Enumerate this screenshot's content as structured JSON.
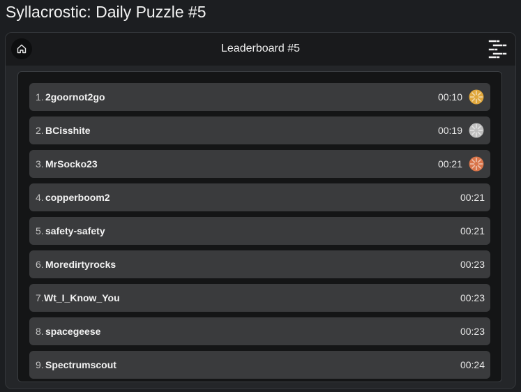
{
  "page_title": "Syllacrostic: Daily Puzzle #5",
  "header": {
    "title": "Leaderboard #5",
    "home_icon": "home-icon",
    "menu_icon": "menu-lines-icon"
  },
  "colors": {
    "gold": "#e0a73c",
    "silver": "#bfbfbf",
    "bronze": "#d9754a"
  },
  "leaderboard": [
    {
      "rank": "1.",
      "name": "2goornot2go",
      "time": "00:10",
      "medal": "gold"
    },
    {
      "rank": "2.",
      "name": "BCisshite",
      "time": "00:19",
      "medal": "silver"
    },
    {
      "rank": "3.",
      "name": "MrSocko23",
      "time": "00:21",
      "medal": "bronze"
    },
    {
      "rank": "4.",
      "name": "copperboom2",
      "time": "00:21",
      "medal": ""
    },
    {
      "rank": "5.",
      "name": "safety-safety",
      "time": "00:21",
      "medal": ""
    },
    {
      "rank": "6.",
      "name": "Moredirtyrocks",
      "time": "00:23",
      "medal": ""
    },
    {
      "rank": "7.",
      "name": "Wt_I_Know_You",
      "time": "00:23",
      "medal": ""
    },
    {
      "rank": "8.",
      "name": "spacegeese",
      "time": "00:23",
      "medal": ""
    },
    {
      "rank": "9.",
      "name": "Spectrumscout",
      "time": "00:24",
      "medal": ""
    }
  ]
}
